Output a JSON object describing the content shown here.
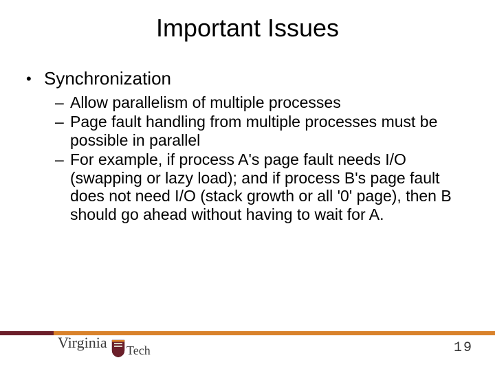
{
  "title": "Important Issues",
  "bullet1": {
    "marker": "•",
    "text": "Synchronization"
  },
  "sub": [
    {
      "dash": "–",
      "text": "Allow parallelism of multiple processes"
    },
    {
      "dash": "–",
      "text": "Page fault handling from multiple processes must be possible in parallel"
    },
    {
      "dash": "–",
      "text": "For example, if process A's page fault needs I/O (swapping or lazy load); and if process B's page fault does not need I/O (stack growth or all '0' page), then B should go ahead without having to wait for A."
    }
  ],
  "logo": {
    "word1": "Virginia",
    "word2": "Tech"
  },
  "page_number": "19"
}
